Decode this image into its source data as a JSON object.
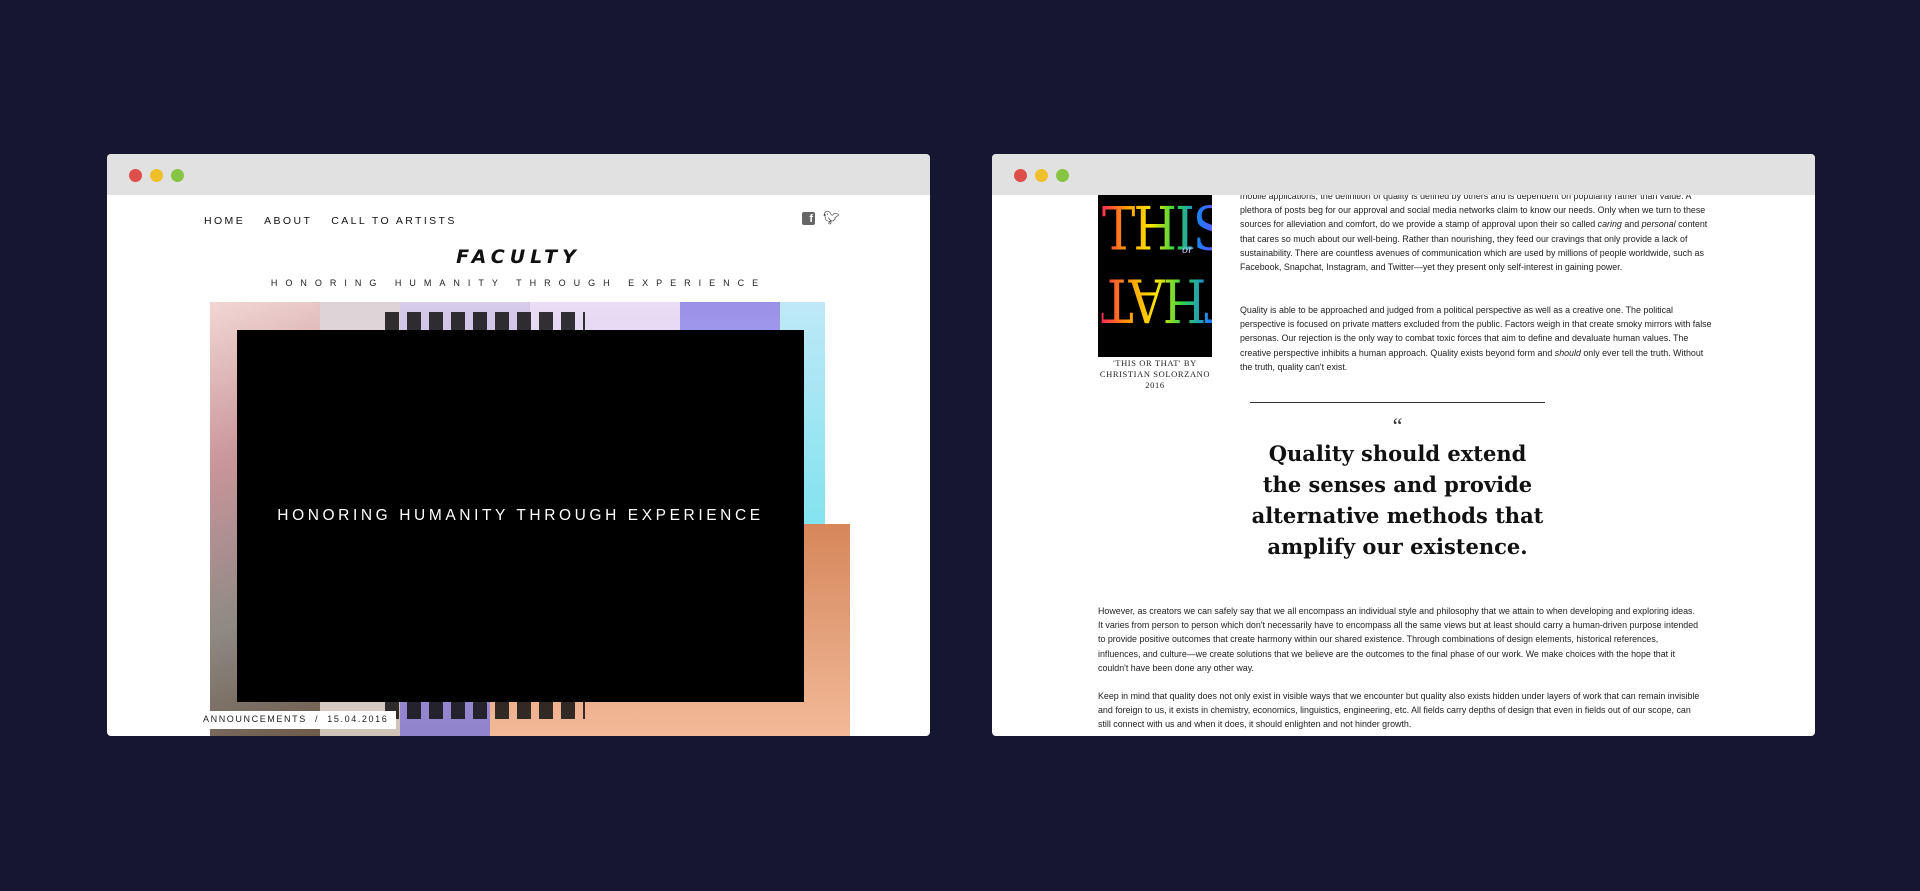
{
  "left": {
    "nav": [
      "HOME",
      "ABOUT",
      "CALL TO ARTISTS"
    ],
    "logo": "FACULTY",
    "tagline": "HONORING HUMANITY THROUGH EXPERIENCE",
    "overlay_text": "HONORING HUMANITY THROUGH EXPERIENCE",
    "meta": "ANNOUNCEMENTS  /  15.04.2016",
    "icons": [
      "facebook-icon",
      "twitter-icon"
    ]
  },
  "right": {
    "artwork": {
      "top": "THIS",
      "or": "or",
      "bottom": "THAT"
    },
    "caption": "'THIS OR THAT' BY CHRISTIAN SOLORZANO 2016",
    "para1": [
      "mobile applications, the definition of quality is defined by others and is dependent on popularity rather than value. A plethora of posts beg for our approval and social media networks claim to know our needs. Only when we turn to these sources for alleviation and comfort, do we provide a stamp of approval upon their so called ",
      "caring",
      " and ",
      "personal",
      " content that cares so much about our well-being. Rather than nourishing, they feed our cravings that only provide a lack of sustainability. There are countless avenues of communication which are used by millions of people worldwide, such as Facebook, Snapchat, Instagram, and Twitter—yet they present only self-interest in gaining power."
    ],
    "para2": [
      "Quality is able to be approached and judged from a political perspective as well as a creative one. The political perspective is focused on private matters excluded from the public. Factors weigh in that create smoky mirrors with false personas. Our rejection is the only way to combat toxic forces that aim to define and devaluate human values. The creative perspective inhibits a human approach. Quality exists beyond form and ",
      "should",
      " only ever tell the truth. Without the truth, quality can't exist."
    ],
    "quote_mark": "“",
    "pull_quote": "Quality should extend the senses and provide alternative methods that amplify our existence.",
    "para3": "However, as creators we can safely say that we all encompass an individual style and philosophy that we attain to when developing and exploring ideas. It varies from person to person which don't necessarily have to encompass all the same views but at least should carry a human-driven purpose intended to provide positive outcomes that create harmony within our shared existence. Through combinations of design elements, historical references, influences, and culture—we create solutions that we believe are the outcomes to the final phase of our work. We make choices with the hope that it couldn't have been done any other way.",
    "para4": "Keep in mind that quality does not only exist in visible ways that we encounter but quality also exists hidden under layers of work that can remain invisible and foreign to us, it exists in chemistry, economics, linguistics, engineering, etc. All fields carry depths of design that even in fields out of our scope, can still connect with us and when it does,  it should enlighten and not hinder growth."
  },
  "colors": {
    "background": "#171630",
    "titlebar": "#e1e1e1",
    "dot_red": "#de4f4b",
    "dot_yellow": "#f0c02c",
    "dot_green": "#88c443"
  }
}
